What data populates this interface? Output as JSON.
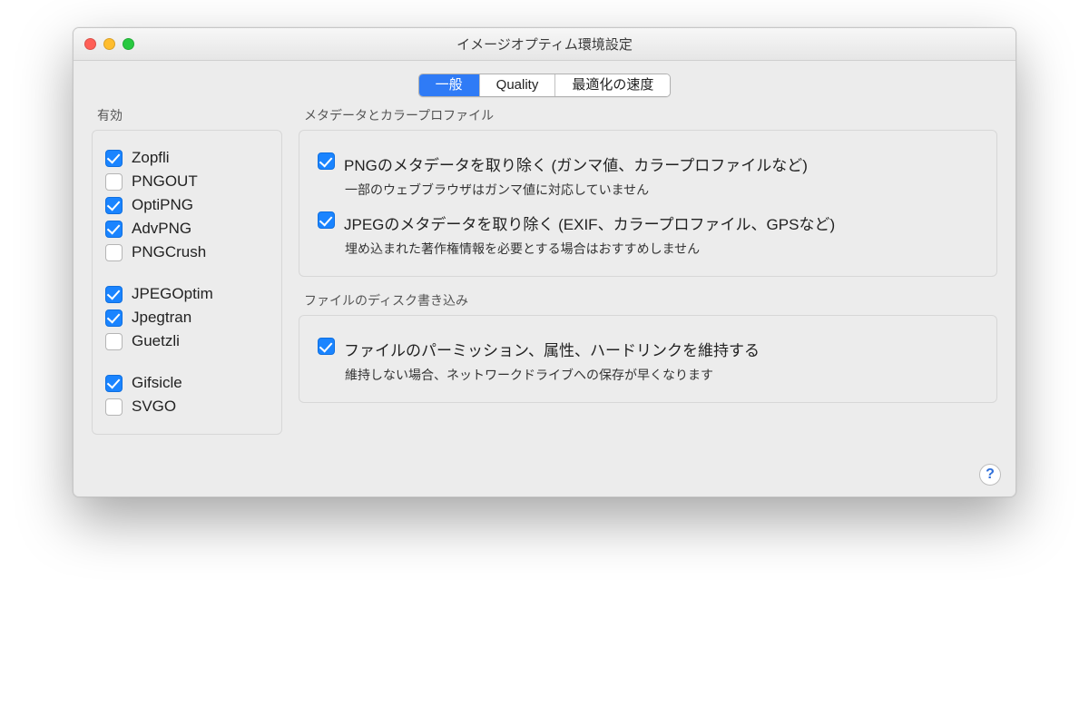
{
  "window": {
    "title": "イメージオプティム環境設定"
  },
  "tabs": {
    "general": "一般",
    "quality": "Quality",
    "speed": "最適化の速度"
  },
  "left": {
    "heading": "有効",
    "items": [
      {
        "label": "Zopfli",
        "checked": true
      },
      {
        "label": "PNGOUT",
        "checked": false
      },
      {
        "label": "OptiPNG",
        "checked": true
      },
      {
        "label": "AdvPNG",
        "checked": true
      },
      {
        "label": "PNGCrush",
        "checked": false
      },
      {
        "label": "JPEGOptim",
        "checked": true
      },
      {
        "label": "Jpegtran",
        "checked": true
      },
      {
        "label": "Guetzli",
        "checked": false
      },
      {
        "label": "Gifsicle",
        "checked": true
      },
      {
        "label": "SVGO",
        "checked": false
      }
    ]
  },
  "meta": {
    "heading": "メタデータとカラープロファイル",
    "png": {
      "label": "PNGのメタデータを取り除く (ガンマ値、カラープロファイルなど)",
      "desc": "一部のウェブブラウザはガンマ値に対応していません",
      "checked": true
    },
    "jpeg": {
      "label": "JPEGのメタデータを取り除く (EXIF、カラープロファイル、GPSなど)",
      "desc": "埋め込まれた著作権情報を必要とする場合はおすすめしません",
      "checked": true
    }
  },
  "disk": {
    "heading": "ファイルのディスク書き込み",
    "perm": {
      "label": "ファイルのパーミッション、属性、ハードリンクを維持する",
      "desc": "維持しない場合、ネットワークドライブへの保存が早くなります",
      "checked": true
    }
  },
  "help": {
    "glyph": "?"
  }
}
